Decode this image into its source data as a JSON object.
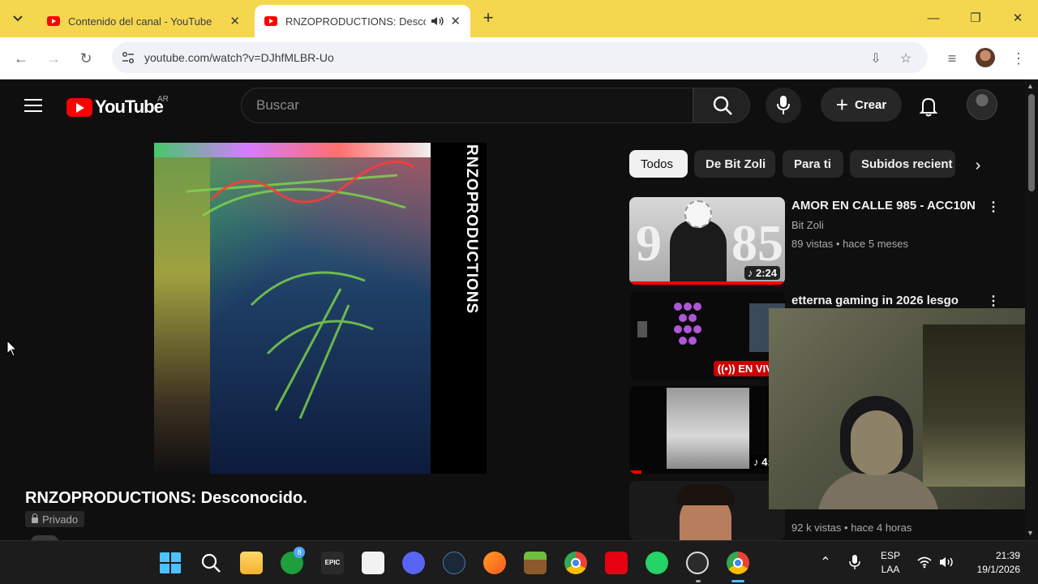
{
  "browser": {
    "tabs": [
      {
        "title": "Contenido del canal - YouTube",
        "active": false
      },
      {
        "title": "RNZOPRODUCTIONS: Desconocido.",
        "active": true,
        "audio": true
      }
    ],
    "new_tab_icon": "plus-icon",
    "url": "youtube.com/watch?v=DJhfMLBR-Uo",
    "window_controls": [
      "minimize",
      "restore",
      "close"
    ]
  },
  "youtube": {
    "logo_text": "YouTube",
    "country_code": "AR",
    "search_placeholder": "Buscar",
    "create_label": "Crear",
    "video": {
      "cover_text": "RNZOPRODUCTIONS",
      "title": "RNZOPRODUCTIONS: Desconocido.",
      "privacy": "Privado"
    },
    "chips": [
      "Todos",
      "De Bit Zoli",
      "Para ti",
      "Subidos recient"
    ],
    "recommendations": [
      {
        "title": "AMOR EN CALLE 985 - ACC10N",
        "channel": "Bit Zoli",
        "meta": "89 vistas • hace 5 meses",
        "badge": "2:24",
        "progress": 1.0
      },
      {
        "title": "etterna gaming in 2026 lesgo",
        "channel": "",
        "meta": "",
        "badge": "EN VIVO",
        "live": true
      },
      {
        "title": "",
        "channel": "",
        "meta": "",
        "badge": "4:3",
        "progress": 0.08
      },
      {
        "title": "",
        "channel": "",
        "meta": "92 k vistas • hace 4 horas",
        "badge": ""
      }
    ]
  },
  "taskbar": {
    "apps": [
      "windows-start",
      "search",
      "file-explorer",
      "xbox",
      "epic-games",
      "capcut",
      "discord",
      "steam",
      "fl-studio",
      "minecraft",
      "chrome",
      "nintendo-switch",
      "whatsapp",
      "obs",
      "chrome-profile"
    ],
    "xbox_badge": "8",
    "language": "ESP",
    "layout": "LAA",
    "time": "21:39",
    "date": "19/1/2026"
  },
  "colors": {
    "tab_strip": "#f5d74f",
    "yt_red": "#ff0000",
    "bg": "#0f0f0f"
  }
}
